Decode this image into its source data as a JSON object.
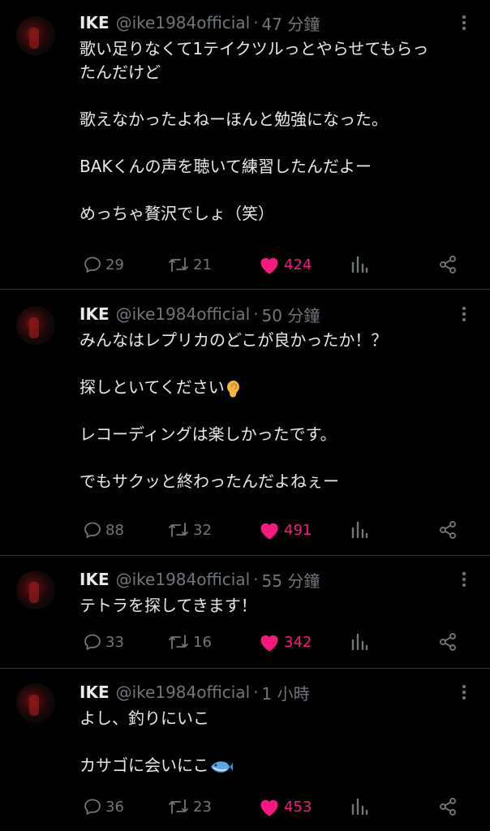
{
  "tweets": [
    {
      "name": "IKE",
      "handle": "@ike1984official",
      "time": "47 分鐘",
      "lines": [
        "歌い足りなくて1テイクツルっとやらせてもらっ",
        "たんだけど",
        "歌えなかったよねーほんと勉強になった。",
        "BAKくんの声を聴いて練習したんだよー",
        "めっちゃ贅沢でしょ（笑）"
      ],
      "replies": "29",
      "retweets": "21",
      "likes": "424"
    },
    {
      "name": "IKE",
      "handle": "@ike1984official",
      "time": "50 分鐘",
      "lines": [
        "みんなはレプリカのどこが良かったか！？",
        "探しといてください",
        "レコーディングは楽しかったです。",
        "でもサクッと終わったんだよねぇー"
      ],
      "emoji": "ear-emoji",
      "replies": "88",
      "retweets": "32",
      "likes": "491"
    },
    {
      "name": "IKE",
      "handle": "@ike1984official",
      "time": "55 分鐘",
      "lines": [
        "テトラを探してきます！"
      ],
      "replies": "33",
      "retweets": "16",
      "likes": "342"
    },
    {
      "name": "IKE",
      "handle": "@ike1984official",
      "time": "1 小時",
      "lines": [
        "よし、釣りにいこ",
        "カサゴに会いにこ"
      ],
      "emoji": "fish-emoji",
      "replies": "36",
      "retweets": "23",
      "likes": "453"
    }
  ],
  "colors": {
    "background": "#000000",
    "text": "#e7e9ea",
    "muted": "#71767b",
    "like": "#f91880",
    "divider": "#2f3336"
  },
  "separator": "·"
}
